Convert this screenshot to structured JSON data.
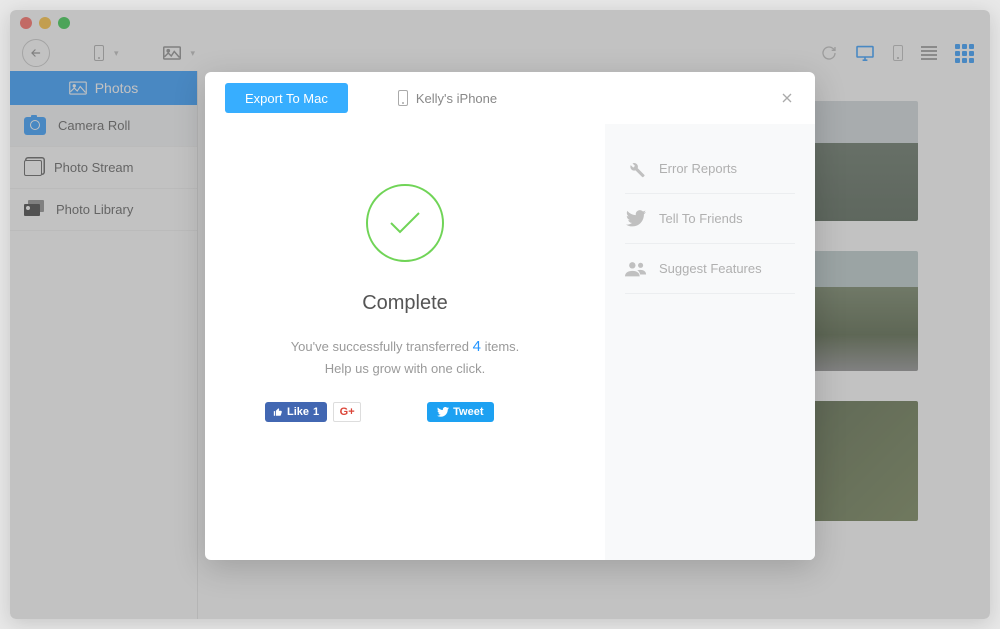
{
  "sidebar": {
    "title": "Photos",
    "items": [
      {
        "label": "Camera Roll"
      },
      {
        "label": "Photo Stream"
      },
      {
        "label": "Photo Library"
      }
    ]
  },
  "modal": {
    "export_label": "Export To Mac",
    "device_name": "Kelly's iPhone",
    "complete_title": "Complete",
    "success_prefix": "You've successfully transferred ",
    "item_count": "4",
    "success_suffix": " items.",
    "help_text": "Help us grow with one click.",
    "fb_like_label": "Like",
    "fb_like_count": "1",
    "gplus_label": "G+",
    "tweet_label": "Tweet",
    "options": [
      {
        "label": "Error Reports"
      },
      {
        "label": "Tell To Friends"
      },
      {
        "label": "Suggest Features"
      }
    ]
  }
}
